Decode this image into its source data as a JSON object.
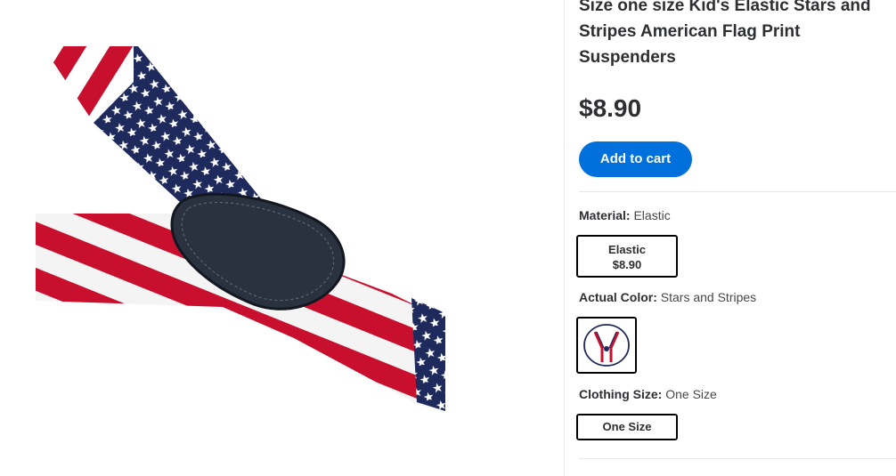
{
  "product": {
    "title": "Size one size Kid's Elastic Stars and Stripes American Flag Print Suspenders",
    "price": "$8.90",
    "add_to_cart_label": "Add to cart"
  },
  "options": {
    "material": {
      "label": "Material:",
      "value": "Elastic",
      "choice_name": "Elastic",
      "choice_price": "$8.90"
    },
    "color": {
      "label": "Actual Color:",
      "value": "Stars and Stripes"
    },
    "size": {
      "label": "Clothing Size:",
      "value": "One Size",
      "choice_name": "One Size"
    }
  },
  "colors": {
    "accent": "#0071dc",
    "flag_red": "#c8102e",
    "flag_blue": "#1f2a5c",
    "text": "#2e2f32"
  }
}
